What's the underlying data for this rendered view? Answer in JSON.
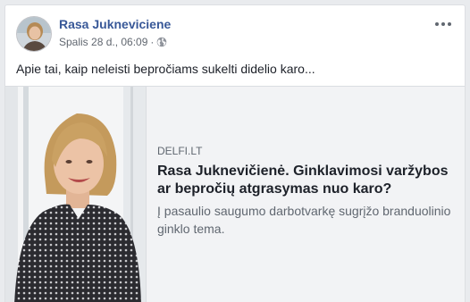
{
  "post": {
    "author": "Rasa Jukneviciene",
    "date": "Spalis 28 d., 06:09",
    "separator": "·",
    "privacy_icon": "globe-icon",
    "more_icon": "more-options-icon",
    "message": "Apie tai, kaip neleisti bepročiams sukelti didelio karo...",
    "link": {
      "domain": "DELFI.LT",
      "headline_line1": "Rasa Juknevičienė. Ginklavimosi varžybos",
      "headline_line2": "ar bepročių atgrasymas nuo karo?",
      "description_line1": "Į pasaulio saugumo darbotvarkę sugrįžo branduolinio",
      "description_line2": "ginklo tema."
    }
  },
  "colors": {
    "author_link": "#385898",
    "meta_text": "#616770",
    "card_bg": "#f2f3f5",
    "page_bg": "#e9ebee"
  }
}
